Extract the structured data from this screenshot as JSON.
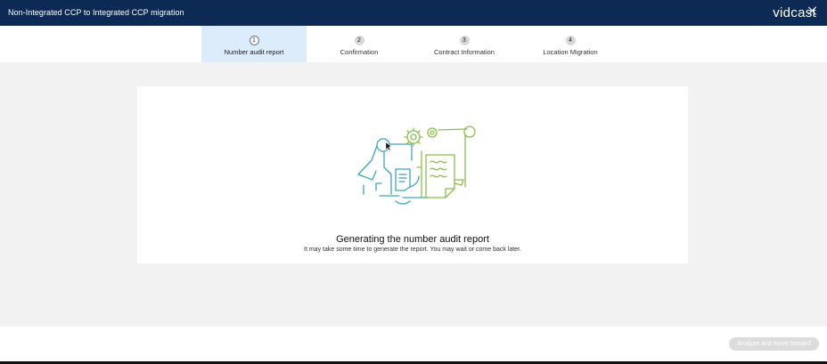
{
  "header": {
    "title": "Non-Integrated CCP to Integrated CCP migration",
    "logo": "vidcast"
  },
  "steps": [
    {
      "number": "1",
      "label": "Number audit report",
      "active": true
    },
    {
      "number": "2",
      "label": "Confirmation",
      "active": false
    },
    {
      "number": "3",
      "label": "Contract Information",
      "active": false
    },
    {
      "number": "4",
      "label": "Location Migration",
      "active": false
    }
  ],
  "main": {
    "heading": "Generating the number audit report",
    "subtext": "It may take some time to generate the report. You may wait or come back later."
  },
  "footer": {
    "analyze_label": "Analyze and move forward"
  },
  "colors": {
    "header_bg": "#0d2a55",
    "active_step_bg": "#dcecfb",
    "illustration_teal": "#3aa8c0",
    "illustration_green": "#8ac04a"
  }
}
